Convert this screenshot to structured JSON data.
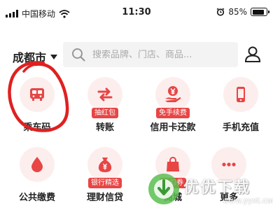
{
  "status_bar": {
    "carrier": "中国移动",
    "time": "11:30",
    "battery": "85%",
    "battery_level": 0.85
  },
  "header": {
    "city": "成都市",
    "search_placeholder": "搜索品牌、门店、商品..."
  },
  "services": [
    {
      "label": "乘车码",
      "icon": "bus-icon",
      "badge": ""
    },
    {
      "label": "转账",
      "icon": "transfer-arrows-icon",
      "badge": "抽红包"
    },
    {
      "label": "信用卡还款",
      "icon": "yuan-hand-icon",
      "badge": "免手续费"
    },
    {
      "label": "手机充值",
      "icon": "phone-icon",
      "badge": ""
    },
    {
      "label": "公共缴费",
      "icon": "drop-icon",
      "badge": ""
    },
    {
      "label": "理财信贷",
      "icon": "money-bag-icon",
      "badge": "银行精选"
    },
    {
      "label": "商城",
      "icon": "shopping-bag-icon",
      "badge": "抵扣券"
    },
    {
      "label": "更多",
      "icon": "more-dots-icon",
      "badge": ""
    }
  ],
  "watermark": {
    "text": "优优下载",
    "url": "www.yyxt.com"
  },
  "colors": {
    "accent": "#e84545",
    "icon_bg": "#fdeeee",
    "annotation": "#e02020"
  }
}
